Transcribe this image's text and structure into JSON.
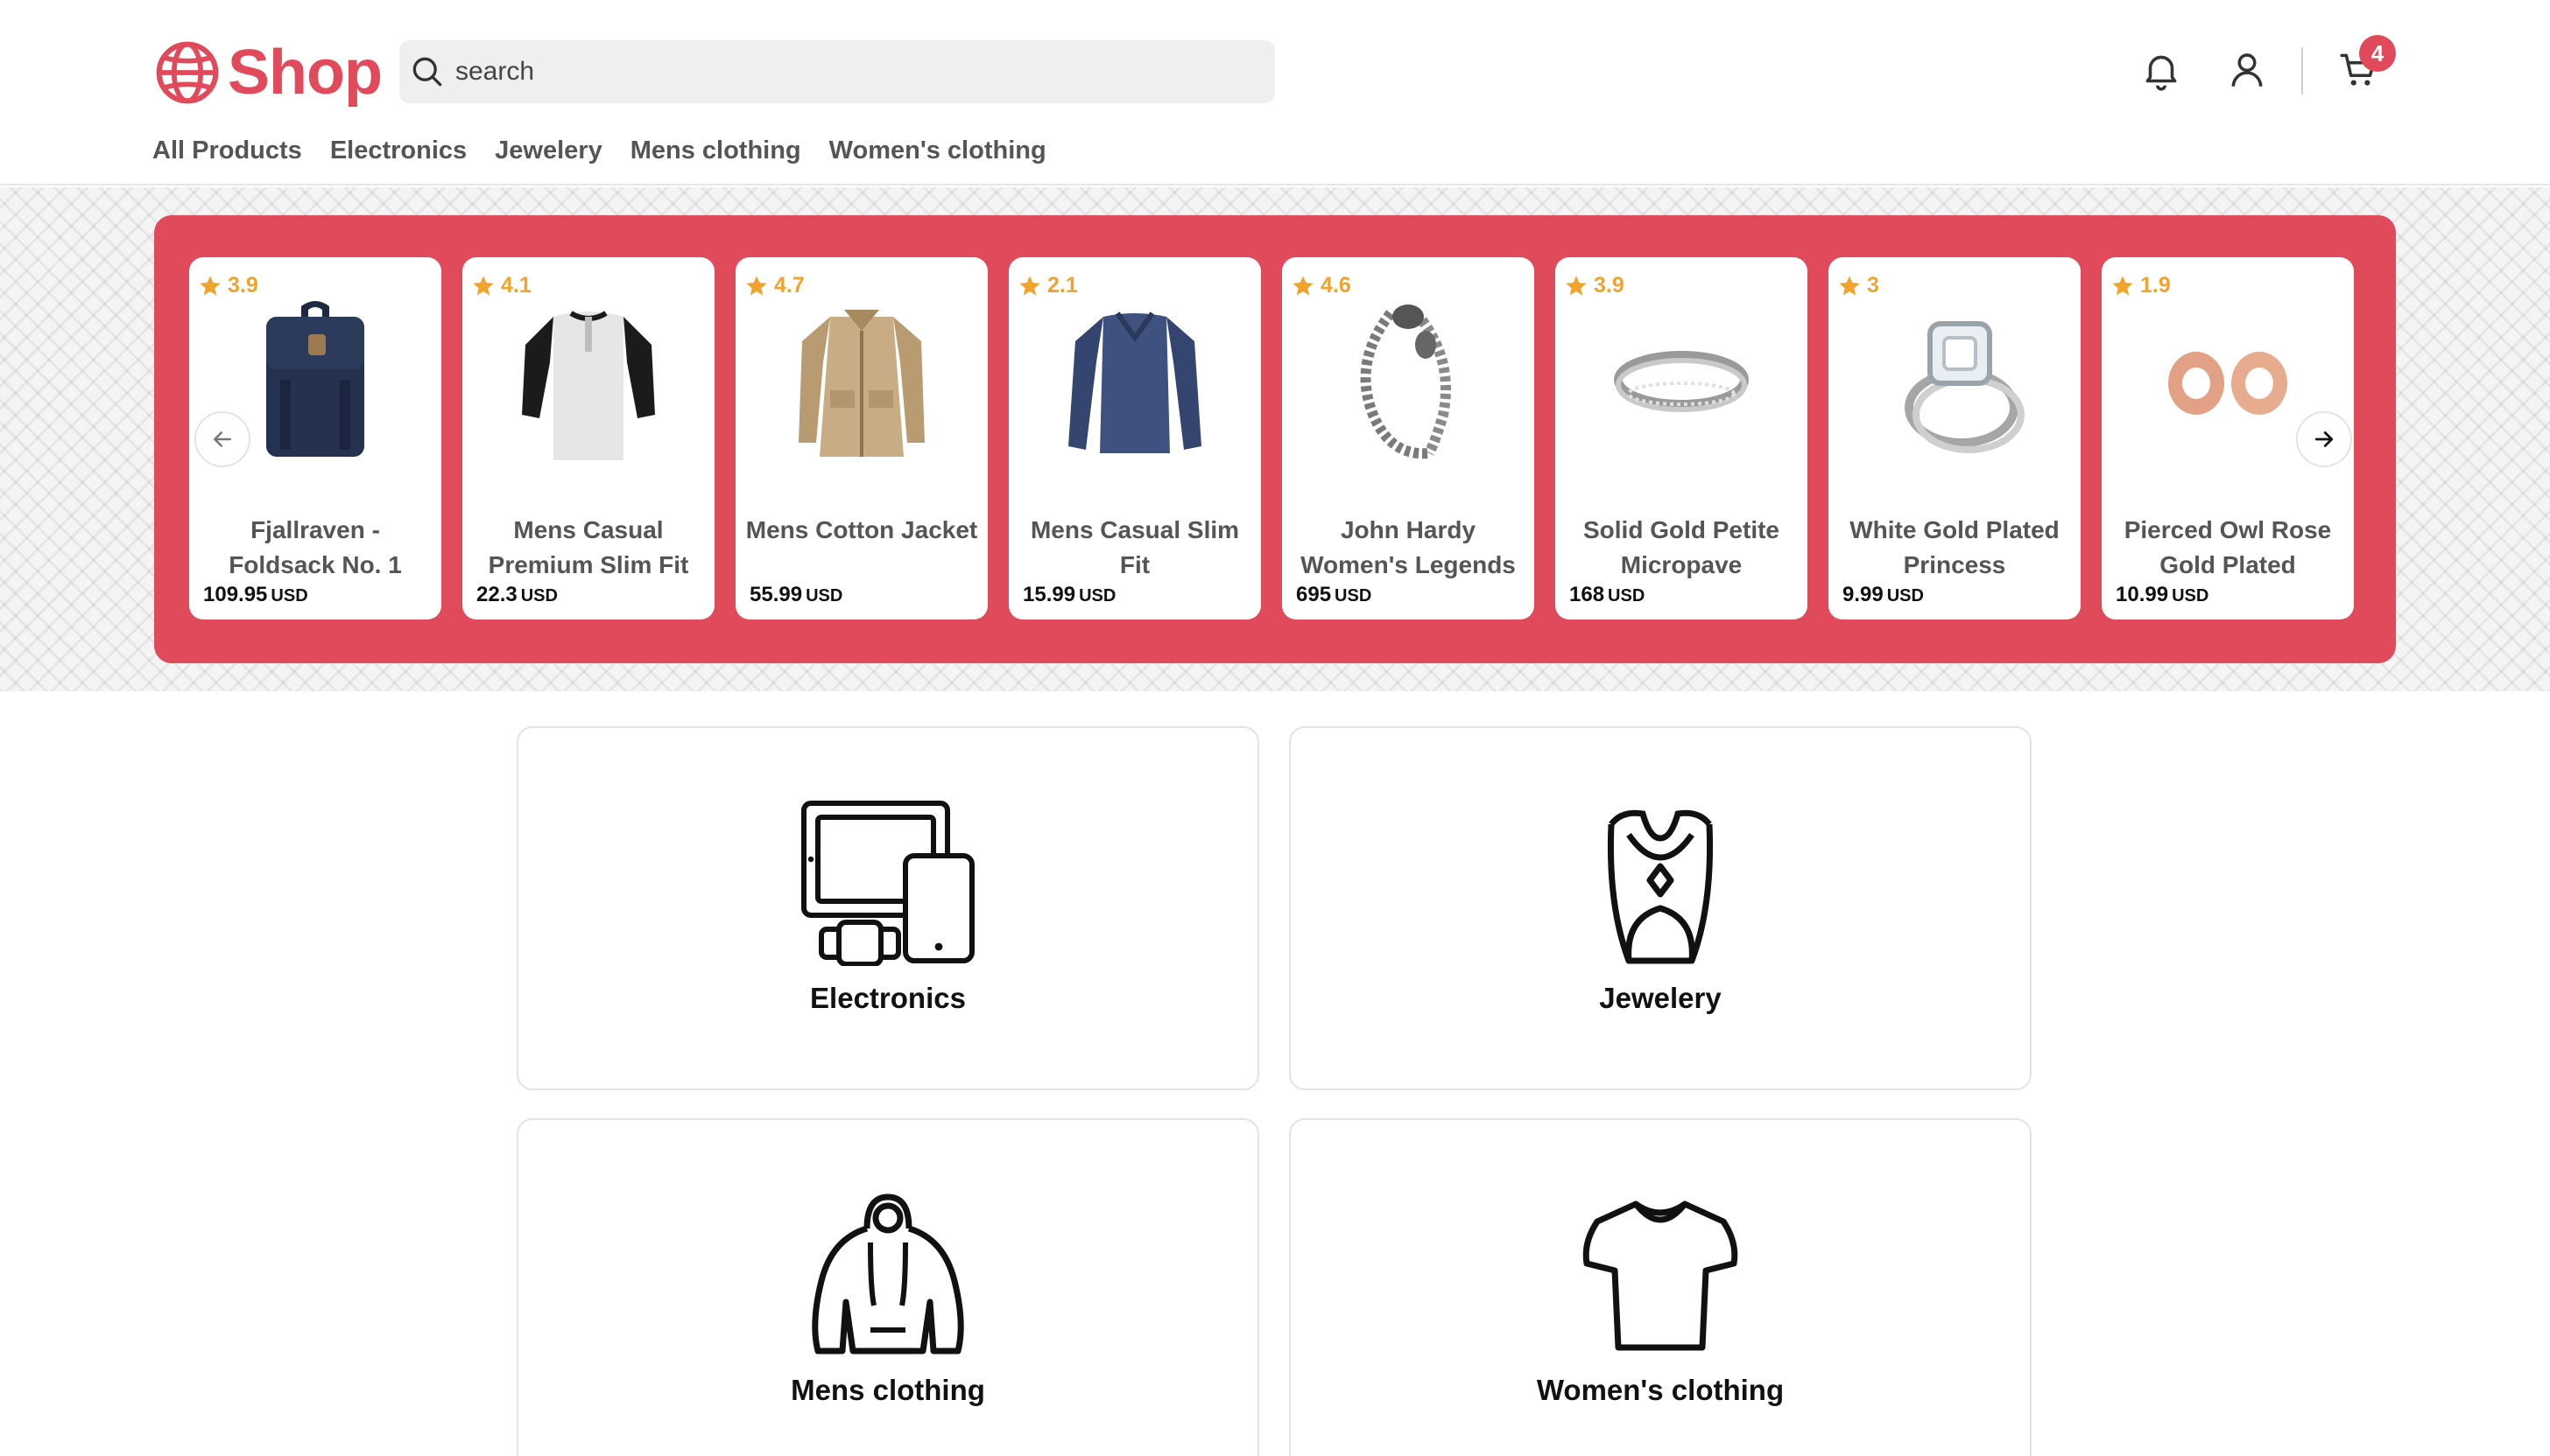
{
  "brand": {
    "name": "Shop",
    "accent": "#e04a5a"
  },
  "search": {
    "placeholder": "search"
  },
  "header": {
    "cart_count": "4"
  },
  "nav": [
    "All Products",
    "Electronics",
    "Jewelery",
    "Mens clothing",
    "Women's clothing"
  ],
  "carousel": {
    "background": "#e04a5a",
    "currency": "USD",
    "products": [
      {
        "rating": "3.9",
        "name": "Fjallraven - Foldsack No. 1",
        "price": "109.95",
        "image": "backpack-icon"
      },
      {
        "rating": "4.1",
        "name": "Mens Casual Premium Slim Fit",
        "price": "22.3",
        "image": "raglan-shirt-icon"
      },
      {
        "rating": "4.7",
        "name": "Mens Cotton Jacket",
        "price": "55.99",
        "image": "jacket-icon"
      },
      {
        "rating": "2.1",
        "name": "Mens Casual Slim Fit",
        "price": "15.99",
        "image": "longsleeve-shirt-icon"
      },
      {
        "rating": "4.6",
        "name": "John Hardy Women's Legends",
        "price": "695",
        "image": "bracelet-icon"
      },
      {
        "rating": "3.9",
        "name": "Solid Gold Petite Micropave",
        "price": "168",
        "image": "ring-band-icon"
      },
      {
        "rating": "3",
        "name": "White Gold Plated Princess",
        "price": "9.99",
        "image": "diamond-ring-icon"
      },
      {
        "rating": "1.9",
        "name": "Pierced Owl Rose Gold Plated",
        "price": "10.99",
        "image": "ear-plugs-icon"
      }
    ]
  },
  "categories": [
    {
      "label": "Electronics",
      "icon": "devices-icon"
    },
    {
      "label": "Jewelery",
      "icon": "necklace-icon"
    },
    {
      "label": "Mens clothing",
      "icon": "hoodie-icon"
    },
    {
      "label": "Women's clothing",
      "icon": "tshirt-icon"
    }
  ]
}
